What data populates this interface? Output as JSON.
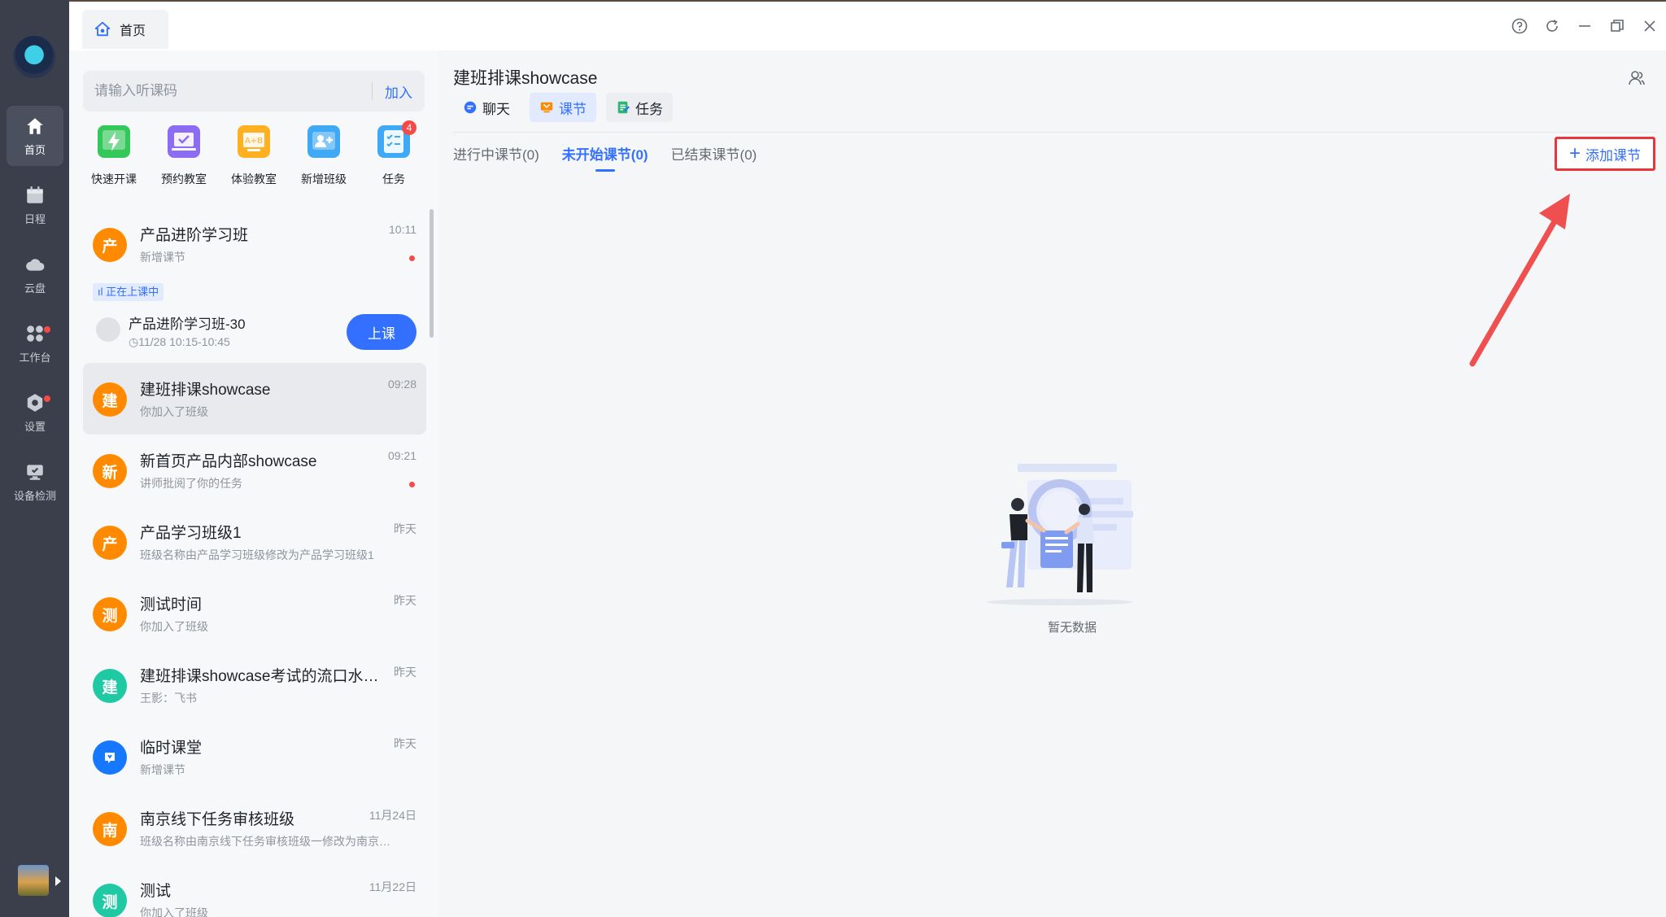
{
  "rail": {
    "items": [
      {
        "label": "首页",
        "icon": "home-icon"
      },
      {
        "label": "日程",
        "icon": "calendar-icon"
      },
      {
        "label": "云盘",
        "icon": "cloud-icon"
      },
      {
        "label": "工作台",
        "icon": "apps-icon"
      },
      {
        "label": "设置",
        "icon": "settings-icon"
      },
      {
        "label": "设备检测",
        "icon": "device-check-icon"
      }
    ]
  },
  "topbar": {
    "tab_label": "首页"
  },
  "sidebar": {
    "search_placeholder": "请输入听课码",
    "join_label": "加入",
    "quick_actions": [
      {
        "label": "快速开课"
      },
      {
        "label": "预约教室"
      },
      {
        "label": "体验教室"
      },
      {
        "label": "新增班级"
      },
      {
        "label": "任务",
        "badge": "4"
      }
    ],
    "conversations": [
      {
        "avatar": "产",
        "title": "产品进阶学习班",
        "subtitle": "新增课节",
        "time": "10:11"
      },
      {
        "avatar": "建",
        "title": "建班排课showcase",
        "subtitle": "你加入了班级",
        "time": "09:28"
      },
      {
        "avatar": "新",
        "title": "新首页产品内部showcase",
        "subtitle": "讲师批阅了你的任务",
        "time": "09:21"
      },
      {
        "avatar": "产",
        "title": "产品学习班级1",
        "subtitle": "班级名称由产品学习班级修改为产品学习班级1",
        "time": "昨天"
      },
      {
        "avatar": "测",
        "title": "测试时间",
        "subtitle": "你加入了班级",
        "time": "昨天"
      },
      {
        "avatar": "建",
        "title": "建班排课showcase考试的流口水…",
        "subtitle": "王影：飞书",
        "time": "昨天"
      },
      {
        "avatar": "",
        "title": "临时课堂",
        "subtitle": "新增课节",
        "time": "昨天"
      },
      {
        "avatar": "南",
        "title": "南京线下任务审核班级",
        "subtitle": "班级名称由南京线下任务审核班级一修改为南京…",
        "time": "11月24日"
      },
      {
        "avatar": "测",
        "title": "测试",
        "subtitle": "你加入了班级",
        "time": "11月22日"
      }
    ],
    "live": {
      "tag": "正在上课中",
      "title": "产品进阶学习班-30",
      "time": "11/28 10:15-10:45",
      "button": "上课"
    }
  },
  "main": {
    "title": "建班排课showcase",
    "chips": [
      {
        "label": "聊天",
        "icon": "chat-icon"
      },
      {
        "label": "课节",
        "icon": "lesson-icon"
      },
      {
        "label": "任务",
        "icon": "task-icon"
      }
    ],
    "subtabs": [
      {
        "label": "进行中课节(0)"
      },
      {
        "label": "未开始课节(0)"
      },
      {
        "label": "已结束课节(0)"
      }
    ],
    "add_button": "添加课节",
    "empty_text": "暂无数据"
  }
}
